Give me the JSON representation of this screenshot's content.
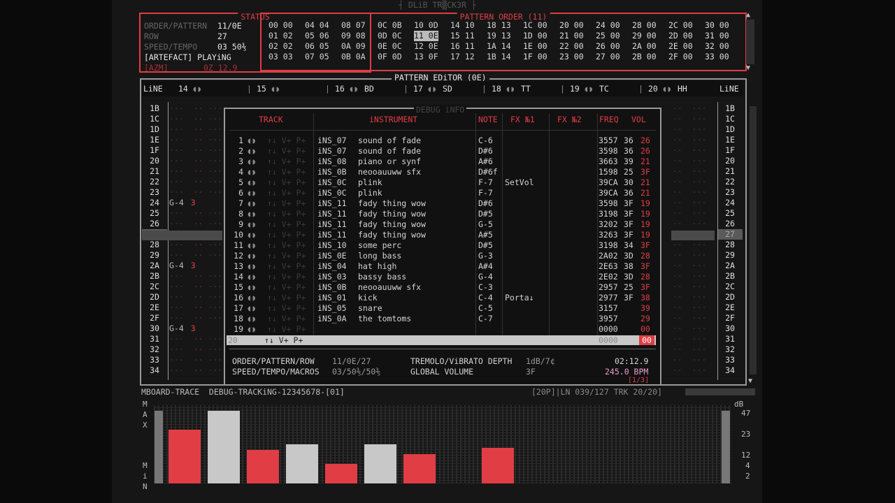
{
  "app_title": "┤ DLiB TR▒CK3R ├",
  "status": {
    "title": "STATUS",
    "labels": [
      "ORDER/PATTERN",
      "ROW",
      "SPEED/TEMPO"
    ],
    "values": [
      "11/0E",
      "27",
      "03 50⅗"
    ],
    "song": "[ARTEFACT] PLAYiNG",
    "footer_left": "[AZM]",
    "footer_time": "0Z 12.9"
  },
  "order": {
    "title": "PATTERN ORDER (11)",
    "rows": [
      [
        "00 00",
        "04 04",
        "08 07",
        "0C 0B",
        "10 0D",
        "14 10",
        "18 13",
        "1C 00",
        "20 00",
        "24 00",
        "28 00",
        "2C 00",
        "30 00"
      ],
      [
        "01 02",
        "05 06",
        "09 08",
        "0D 0C",
        "11 0E",
        "15 11",
        "19 13",
        "1D 00",
        "21 00",
        "25 00",
        "29 00",
        "2D 00",
        "31 00"
      ],
      [
        "02 02",
        "06 05",
        "0A 09",
        "0E 0C",
        "12 0E",
        "16 11",
        "1A 14",
        "1E 00",
        "22 00",
        "26 00",
        "2A 00",
        "2E 00",
        "32 00"
      ],
      [
        "03 03",
        "07 05",
        "0B 0A",
        "0F 0D",
        "13 0F",
        "17 12",
        "1B 14",
        "1F 00",
        "23 00",
        "27 00",
        "2B 00",
        "2F 00",
        "33 00"
      ]
    ]
  },
  "pattern_editor": {
    "title": "PATTERN EDiTOR (0E)",
    "line_label": "LiNE",
    "channels": [
      {
        "num": "14",
        "name": ""
      },
      {
        "num": "15",
        "name": ""
      },
      {
        "num": "16",
        "name": "BD"
      },
      {
        "num": "17",
        "name": "SD"
      },
      {
        "num": "18",
        "name": "TT"
      },
      {
        "num": "19",
        "name": "TC"
      },
      {
        "num": "20",
        "name": "HH"
      }
    ],
    "lines": [
      "1B",
      "1C",
      "1D",
      "1E",
      "1F",
      "20",
      "21",
      "22",
      "23",
      "24",
      "25",
      "26",
      "27",
      "28",
      "29",
      "2A",
      "2B",
      "2C",
      "2D",
      "2E",
      "2F",
      "30",
      "31",
      "32",
      "33",
      "34"
    ],
    "note_cells": {
      "24": "G-4",
      "2A": "G-4",
      "30": "G-4"
    },
    "inst_cells": {
      "24": "3",
      "2A": "3",
      "30": "3"
    }
  },
  "debug": {
    "title": "DEBUG iNFO",
    "headers": {
      "track": "TRACK",
      "instrument": "iNSTRUMENT",
      "note": "NOTE",
      "fx1": "FX №1",
      "fx2": "FX №2",
      "freq": "FREQ",
      "vol": "VOL"
    },
    "rows": [
      {
        "n": "1",
        "ins": "iNS_07",
        "name": "sound of fade",
        "note": "C-6",
        "fx1": "",
        "freq": "3557",
        "a": "36",
        "vol": "26"
      },
      {
        "n": "2",
        "ins": "iNS_07",
        "name": "sound of fade",
        "note": "D#6",
        "fx1": "",
        "freq": "3598",
        "a": "36",
        "vol": "26"
      },
      {
        "n": "3",
        "ins": "iNS_08",
        "name": "piano or synf",
        "note": "A#6",
        "fx1": "",
        "freq": "3663",
        "a": "39",
        "vol": "21"
      },
      {
        "n": "4",
        "ins": "iNS_0B",
        "name": "neooauuww sfx",
        "note": "D#6f",
        "fx1": "",
        "freq": "1598",
        "a": "25",
        "vol": "3F"
      },
      {
        "n": "5",
        "ins": "iNS_0C",
        "name": "plink",
        "note": "F-7",
        "fx1": "SetVol",
        "freq": "39CA",
        "a": "30",
        "vol": "21"
      },
      {
        "n": "6",
        "ins": "iNS_0C",
        "name": "plink",
        "note": "F-7",
        "fx1": "",
        "freq": "39CA",
        "a": "36",
        "vol": "21"
      },
      {
        "n": "7",
        "ins": "iNS_11",
        "name": "fady thing wow",
        "note": "D#6",
        "fx1": "",
        "freq": "3598",
        "a": "3F",
        "vol": "19"
      },
      {
        "n": "8",
        "ins": "iNS_11",
        "name": "fady thing wow",
        "note": "D#5",
        "fx1": "",
        "freq": "3198",
        "a": "3F",
        "vol": "19"
      },
      {
        "n": "9",
        "ins": "iNS_11",
        "name": "fady thing wow",
        "note": "G-5",
        "fx1": "",
        "freq": "3202",
        "a": "3F",
        "vol": "19"
      },
      {
        "n": "10",
        "ins": "iNS_11",
        "name": "fady thing wow",
        "note": "A#5",
        "fx1": "",
        "freq": "3263",
        "a": "3F",
        "vol": "19"
      },
      {
        "n": "11",
        "ins": "iNS_10",
        "name": "some perc",
        "note": "D#5",
        "fx1": "",
        "freq": "3198",
        "a": "34",
        "vol": "3F"
      },
      {
        "n": "12",
        "ins": "iNS_0E",
        "name": "long bass",
        "note": "G-3",
        "fx1": "",
        "freq": "2A02",
        "a": "3D",
        "vol": "28"
      },
      {
        "n": "13",
        "ins": "iNS_04",
        "name": "hat high",
        "note": "A#4",
        "fx1": "",
        "freq": "2E63",
        "a": "38",
        "vol": "3F"
      },
      {
        "n": "14",
        "ins": "iNS_03",
        "name": "bassy bass",
        "note": "G-4",
        "fx1": "",
        "freq": "2E02",
        "a": "3D",
        "vol": "28"
      },
      {
        "n": "15",
        "ins": "iNS_0B",
        "name": "neooauuww sfx",
        "note": "C-3",
        "fx1": "",
        "freq": "2957",
        "a": "25",
        "vol": "3F"
      },
      {
        "n": "16",
        "ins": "iNS_01",
        "name": "kick",
        "note": "C-4",
        "fx1": "Porta↓",
        "freq": "2977",
        "a": "3F",
        "vol": "38"
      },
      {
        "n": "17",
        "ins": "iNS_05",
        "name": "snare",
        "note": "C-5",
        "fx1": "",
        "freq": "3157",
        "a": "",
        "vol": "39"
      },
      {
        "n": "18",
        "ins": "iNS_0A",
        "name": "the tomtoms",
        "note": "C-7",
        "fx1": "",
        "freq": "3957",
        "a": "",
        "vol": "29"
      },
      {
        "n": "19",
        "ins": "",
        "name": "",
        "note": "",
        "fx1": "",
        "freq": "0000",
        "a": "",
        "vol": "00"
      }
    ],
    "hl_row": {
      "n": "20",
      "freq": "0000",
      "vol": "00"
    },
    "footer": {
      "l1_label": "ORDER/PATTERN/ROW",
      "l1_val": "11/0E/27",
      "l2_label": "SPEED/TEMPO/MACROS",
      "l2_val": "03/50⅗/50⅗",
      "r1_label": "TREMOLO/ViBRATO DEPTH",
      "r1_val": "1dB/7¢",
      "r1_time": "02:12.9",
      "r2_label": "GLOBAL VOLUME",
      "r2_val": "3F",
      "bpm": "245.0 BPM",
      "page": "[1/3]"
    }
  },
  "bottom_status": "MBOARD-TRACE  DEBUG-TRACKiNG-12345678-[01]",
  "bottom_status_right": "[20P]|LN 039/127 TRK 20/20]",
  "analyzer": {
    "left_top": "MAX",
    "left_bottom": "MiN",
    "db_label": "dB",
    "scale": [
      "47",
      "23",
      "12",
      "4",
      "2"
    ],
    "levels": [
      0.74,
      1.0,
      0.46,
      0.54,
      0.27,
      0.54,
      0.4,
      0.0,
      0.49
    ],
    "colors": [
      "#e03d45",
      "#c8c8c8",
      "#e03d45",
      "#c8c8c8",
      "#e03d45",
      "#c8c8c8",
      "#e03d45",
      "#c8c8c8",
      "#e03d45"
    ]
  }
}
